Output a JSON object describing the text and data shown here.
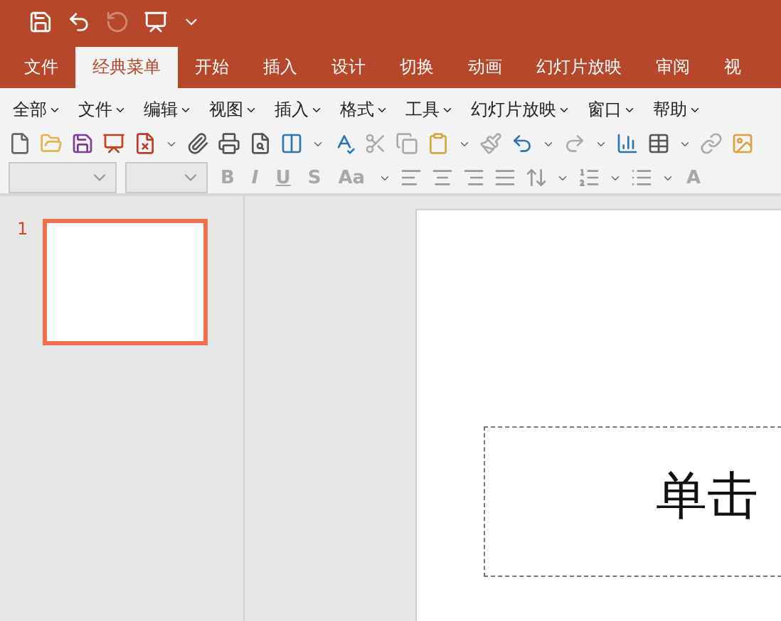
{
  "quick_access": [
    {
      "kind": "save",
      "disabled": false
    },
    {
      "kind": "undo",
      "disabled": false
    },
    {
      "kind": "redo",
      "disabled": true
    },
    {
      "kind": "present",
      "disabled": false
    },
    {
      "kind": "customize",
      "disabled": false
    }
  ],
  "tabs": [
    {
      "label": "文件",
      "selected": false
    },
    {
      "label": "经典菜单",
      "selected": true
    },
    {
      "label": "开始",
      "selected": false
    },
    {
      "label": "插入",
      "selected": false
    },
    {
      "label": "设计",
      "selected": false
    },
    {
      "label": "切换",
      "selected": false
    },
    {
      "label": "动画",
      "selected": false
    },
    {
      "label": "幻灯片放映",
      "selected": false
    },
    {
      "label": "审阅",
      "selected": false
    },
    {
      "label": "视",
      "selected": false
    }
  ],
  "menus": [
    "全部",
    "文件",
    "编辑",
    "视图",
    "插入",
    "格式",
    "工具",
    "幻灯片放映",
    "窗口",
    "帮助"
  ],
  "format_buttons": [
    {
      "label": "B",
      "kind": "bold",
      "disabled": true
    },
    {
      "label": "I",
      "kind": "italic",
      "disabled": true
    },
    {
      "label": "U",
      "kind": "underline",
      "disabled": true
    },
    {
      "label": "S",
      "kind": "shadow",
      "disabled": true
    },
    {
      "label": "Aa",
      "kind": "case",
      "disabled": true
    }
  ],
  "font_color_button": {
    "label": "A",
    "disabled": true
  },
  "slides": [
    {
      "number": "1",
      "selected": true
    }
  ],
  "slide": {
    "title_placeholder": "单击"
  }
}
